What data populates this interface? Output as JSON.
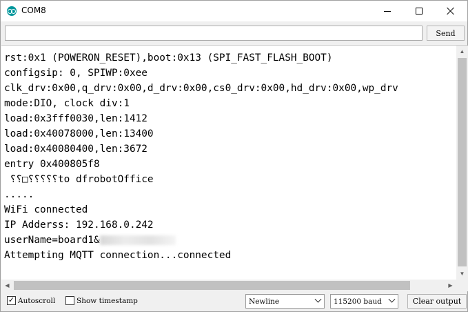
{
  "window": {
    "title": "COM8"
  },
  "send": {
    "input_value": "",
    "button_label": "Send"
  },
  "output": {
    "lines": [
      "rst:0x1 (POWERON_RESET),boot:0x13 (SPI_FAST_FLASH_BOOT)",
      "configsip: 0, SPIWP:0xee",
      "clk_drv:0x00,q_drv:0x00,d_drv:0x00,cs0_drv:0x00,hd_drv:0x00,wp_drv",
      "mode:DIO, clock div:1",
      "load:0x3fff0030,len:1412",
      "load:0x40078000,len:13400",
      "load:0x40080400,len:3672",
      "entry 0x400805f8",
      " ⸮⸮□⸮⸮⸮⸮⸮to dfrobotOffice",
      ".....",
      "WiFi connected",
      "IP Adderss: 192.168.0.242",
      "userName=board1&",
      "Attempting MQTT connection...connected"
    ]
  },
  "footer": {
    "autoscroll": {
      "label": "Autoscroll",
      "checked": true
    },
    "show_timestamp": {
      "label": "Show timestamp",
      "checked": false
    },
    "line_ending": "Newline",
    "baud_rate": "115200 baud",
    "clear_label": "Clear output"
  }
}
